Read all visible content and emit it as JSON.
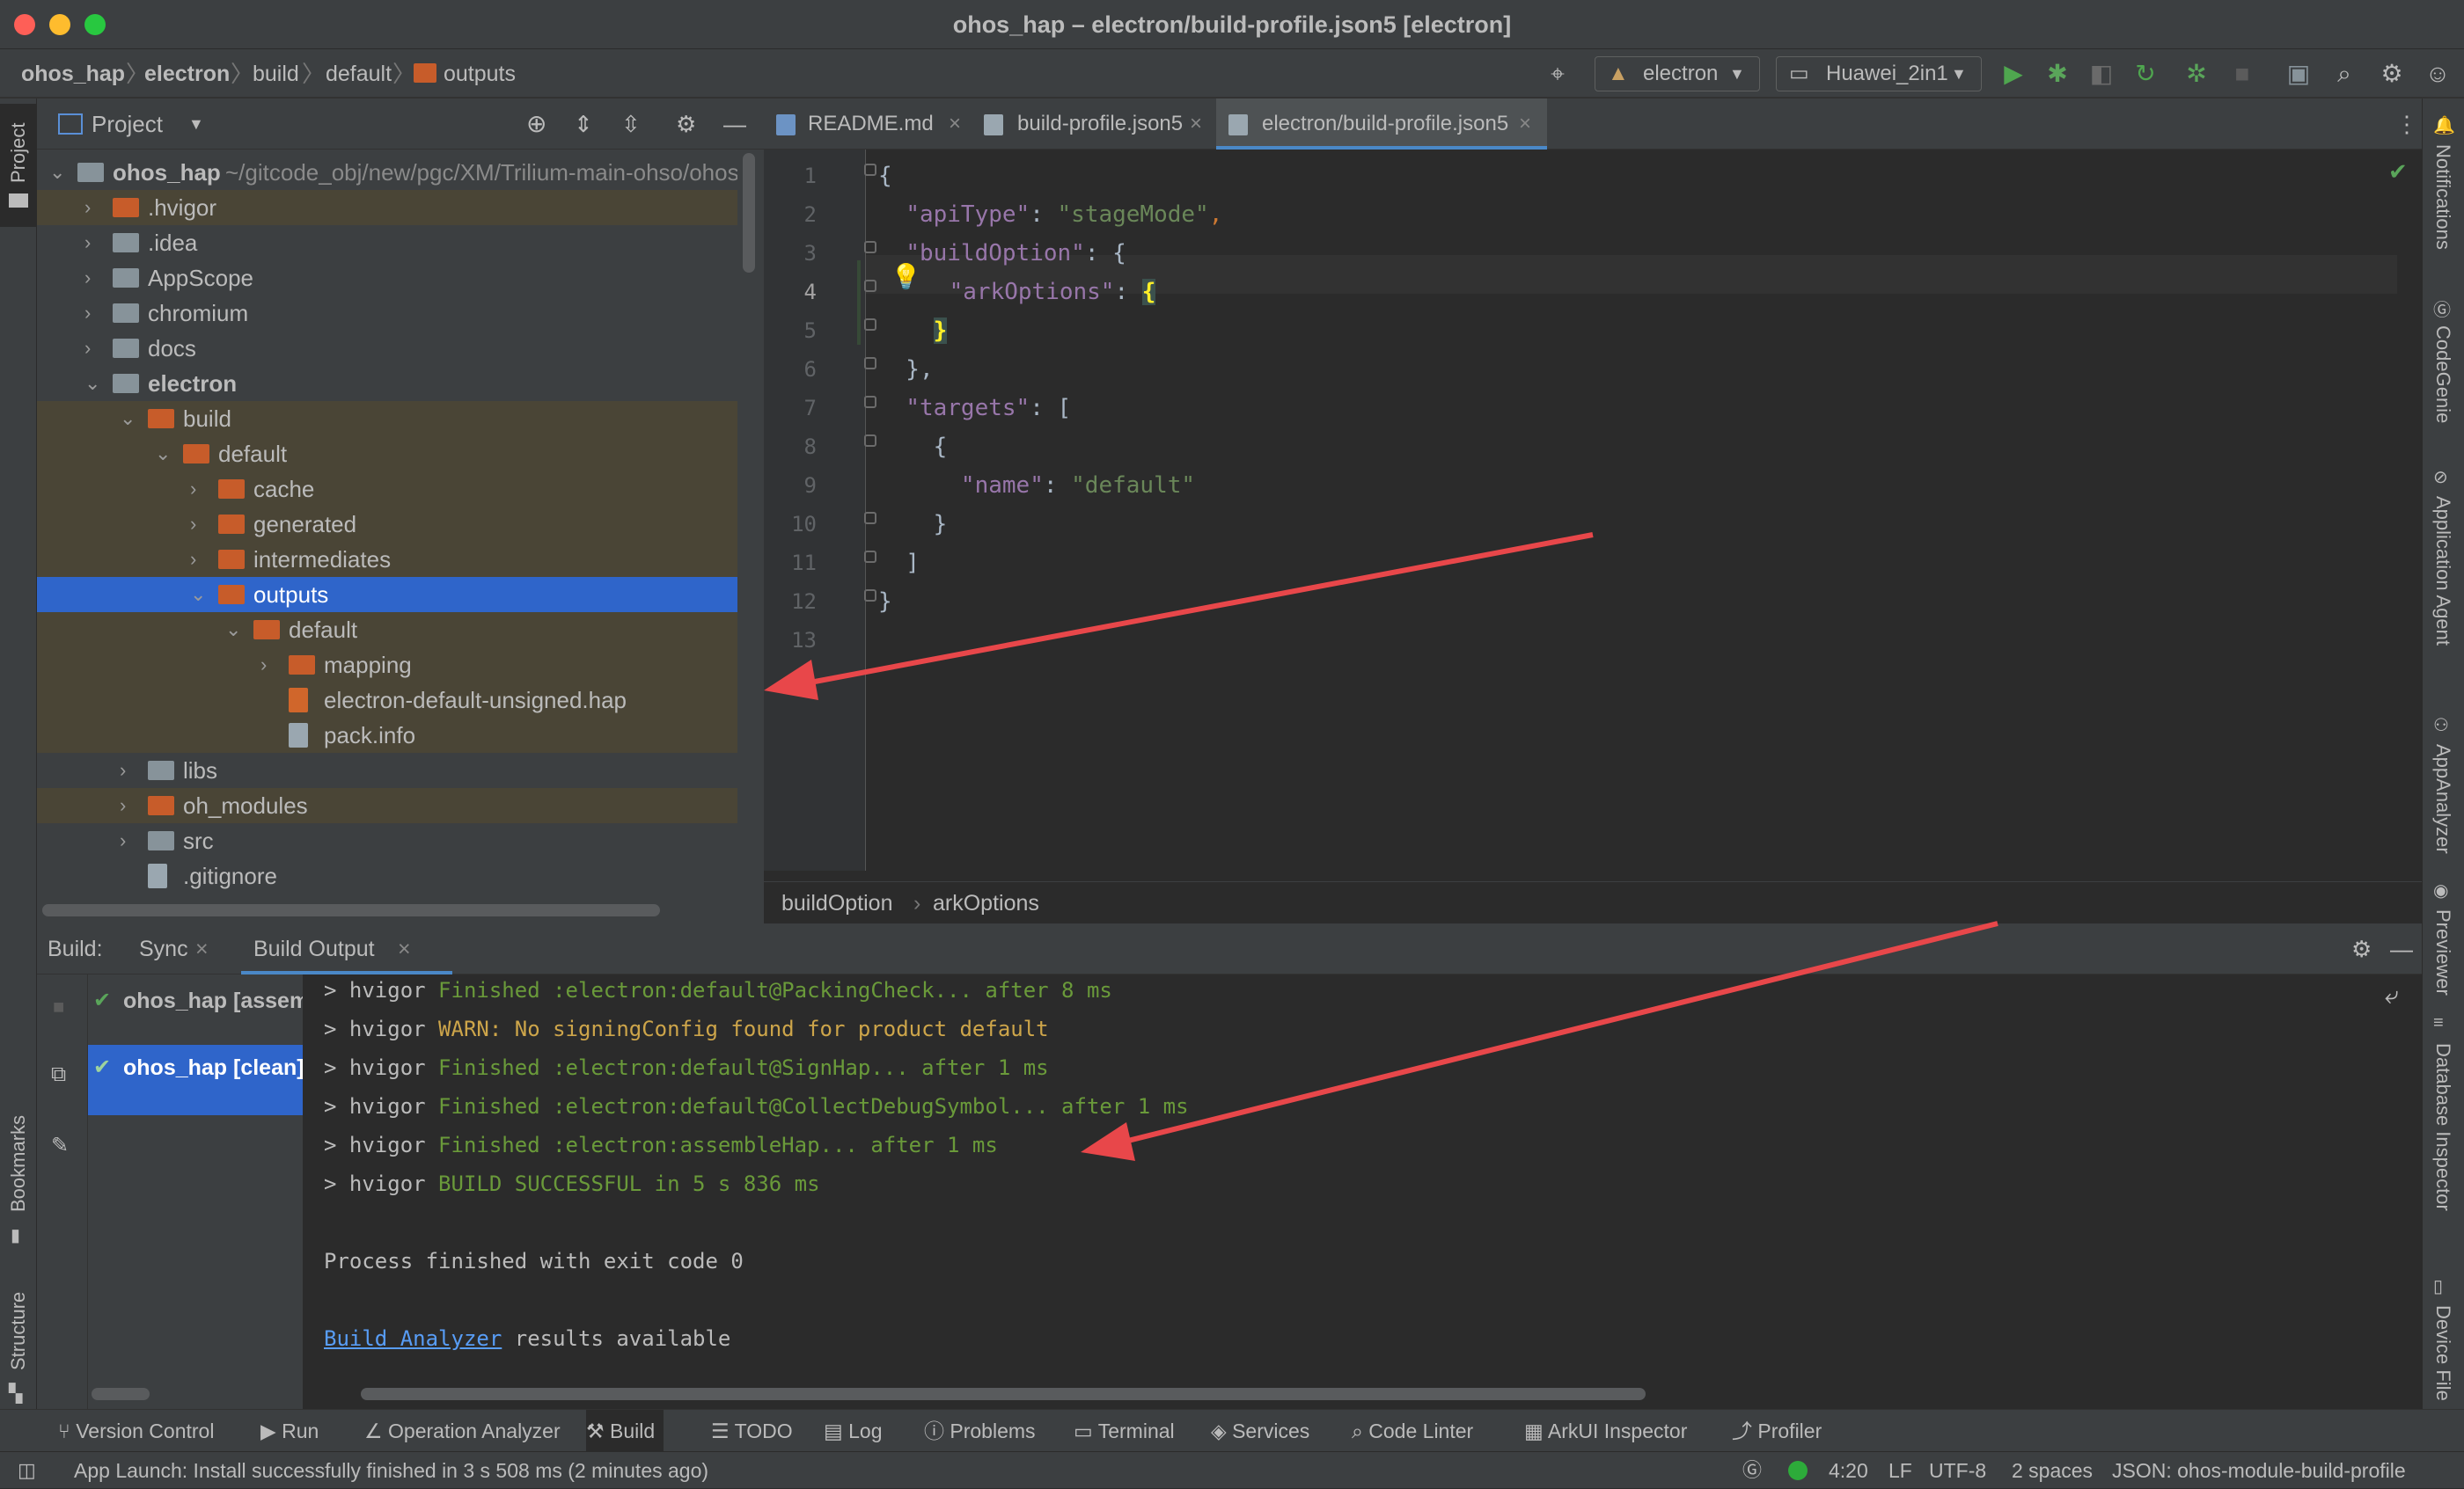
{
  "window": {
    "title": "ohos_hap – electron/build-profile.json5 [electron]"
  },
  "breadcrumb": [
    "ohos_hap",
    "electron",
    "build",
    "default",
    "outputs"
  ],
  "toolbar": {
    "module_select": "electron",
    "device_select": "Huawei_2in1"
  },
  "project_panel": {
    "title": "Project",
    "root_label": "ohos_hap",
    "root_path": "~/gitcode_obj/new/pgc/XM/Trilium-main-ohso/ohos_hap",
    "tree": [
      {
        "label": ".hvigor",
        "depth": 1,
        "kind": "folder-orange",
        "expanded": false,
        "excluded": true
      },
      {
        "label": ".idea",
        "depth": 1,
        "kind": "folder",
        "expanded": false
      },
      {
        "label": "AppScope",
        "depth": 1,
        "kind": "folder",
        "expanded": false
      },
      {
        "label": "chromium",
        "depth": 1,
        "kind": "folder",
        "expanded": false
      },
      {
        "label": "docs",
        "depth": 1,
        "kind": "folder",
        "expanded": false
      },
      {
        "label": "electron",
        "depth": 1,
        "kind": "module",
        "expanded": true,
        "bold": true
      },
      {
        "label": "build",
        "depth": 2,
        "kind": "folder-orange",
        "expanded": true,
        "excluded": true
      },
      {
        "label": "default",
        "depth": 3,
        "kind": "folder-orange",
        "expanded": true,
        "excluded": true
      },
      {
        "label": "cache",
        "depth": 4,
        "kind": "folder-orange",
        "expanded": false,
        "excluded": true
      },
      {
        "label": "generated",
        "depth": 4,
        "kind": "folder-orange",
        "expanded": false,
        "excluded": true
      },
      {
        "label": "intermediates",
        "depth": 4,
        "kind": "folder-orange",
        "expanded": false,
        "excluded": true
      },
      {
        "label": "outputs",
        "depth": 4,
        "kind": "folder-orange",
        "expanded": true,
        "selected": true
      },
      {
        "label": "default",
        "depth": 5,
        "kind": "folder-orange",
        "expanded": true,
        "excluded": true
      },
      {
        "label": "mapping",
        "depth": 6,
        "kind": "folder-orange",
        "expanded": false,
        "excluded": true
      },
      {
        "label": "electron-default-unsigned.hap",
        "depth": 6,
        "kind": "file-hap",
        "leaf": true,
        "excluded": true
      },
      {
        "label": "pack.info",
        "depth": 6,
        "kind": "file",
        "leaf": true,
        "excluded": true
      },
      {
        "label": "libs",
        "depth": 2,
        "kind": "folder",
        "expanded": false
      },
      {
        "label": "oh_modules",
        "depth": 2,
        "kind": "folder-orange",
        "expanded": false,
        "excluded": true
      },
      {
        "label": "src",
        "depth": 2,
        "kind": "folder",
        "expanded": false
      },
      {
        "label": ".gitignore",
        "depth": 2,
        "kind": "file",
        "leaf": true
      }
    ]
  },
  "editor": {
    "tabs": [
      {
        "label": "README.md",
        "active": false
      },
      {
        "label": "build-profile.json5",
        "active": false
      },
      {
        "label": "electron/build-profile.json5",
        "active": true
      }
    ],
    "lines": [
      [
        [
          "{",
          "plain"
        ]
      ],
      [
        [
          "  ",
          "plain"
        ],
        [
          "\"apiType\"",
          "key"
        ],
        [
          ": ",
          "plain"
        ],
        [
          "\"stageMode\"",
          "str"
        ],
        [
          ",",
          "punct"
        ]
      ],
      [
        [
          "  ",
          "plain"
        ],
        [
          "\"buildOption\"",
          "key"
        ],
        [
          ": {",
          "plain"
        ]
      ],
      [
        [
          "    ",
          "plain"
        ],
        [
          "\"arkOptions\"",
          "key"
        ],
        [
          ": ",
          "plain"
        ],
        [
          "{",
          "plain"
        ]
      ],
      [
        [
          "    ",
          "plain"
        ],
        [
          "}",
          "plain"
        ]
      ],
      [
        [
          "  },",
          "plain"
        ]
      ],
      [
        [
          "  ",
          "plain"
        ],
        [
          "\"targets\"",
          "key"
        ],
        [
          ": [",
          "plain"
        ]
      ],
      [
        [
          "    {",
          "plain"
        ]
      ],
      [
        [
          "      ",
          "plain"
        ],
        [
          "\"name\"",
          "key"
        ],
        [
          ": ",
          "plain"
        ],
        [
          "\"default\"",
          "str"
        ]
      ],
      [
        [
          "    }",
          "plain"
        ]
      ],
      [
        [
          "  ]",
          "plain"
        ]
      ],
      [
        [
          "}",
          "plain"
        ]
      ],
      [
        [
          "",
          "plain"
        ]
      ]
    ],
    "line_numbers": [
      "1",
      "2",
      "3",
      "4",
      "5",
      "6",
      "7",
      "8",
      "9",
      "10",
      "11",
      "12",
      "13"
    ],
    "breadcrumb": [
      "buildOption",
      "arkOptions"
    ]
  },
  "build_panel": {
    "label": "Build:",
    "tabs": [
      {
        "label": "Sync"
      },
      {
        "label": "Build Output"
      }
    ],
    "tasks": [
      {
        "label": "ohos_hap [assemble]",
        "selected": false
      },
      {
        "label": "ohos_hap [clean]",
        "selected": true
      }
    ],
    "console": [
      [
        [
          "> hvigor ",
          "plain"
        ],
        [
          "Finished :electron:default@PackingCheck... after 8 ms",
          "ok"
        ]
      ],
      [
        [
          "> hvigor ",
          "plain"
        ],
        [
          "WARN: No signingConfig found for product default",
          "warn"
        ]
      ],
      [
        [
          "> hvigor ",
          "plain"
        ],
        [
          "Finished :electron:default@SignHap... after 1 ms",
          "ok"
        ]
      ],
      [
        [
          "> hvigor ",
          "plain"
        ],
        [
          "Finished :electron:default@CollectDebugSymbol... after 1 ms",
          "ok"
        ]
      ],
      [
        [
          "> hvigor ",
          "plain"
        ],
        [
          "Finished :electron:assembleHap... after 1 ms",
          "ok"
        ]
      ],
      [
        [
          "> hvigor ",
          "plain"
        ],
        [
          "BUILD SUCCESSFUL in 5 s 836 ms",
          "ok"
        ]
      ],
      [
        [
          "",
          "plain"
        ]
      ],
      [
        [
          "Process finished with exit code 0",
          "plain"
        ]
      ],
      [
        [
          "",
          "plain"
        ]
      ],
      [
        [
          "Build Analyzer",
          "link"
        ],
        [
          " results available",
          "plain"
        ]
      ]
    ]
  },
  "tool_windows": [
    "Version Control",
    "Run",
    "Operation Analyzer",
    "Build",
    "TODO",
    "Log",
    "Problems",
    "Terminal",
    "Services",
    "Code Linter",
    "ArkUI Inspector",
    "Profiler"
  ],
  "left_strip": {
    "top": "Project",
    "bottom": [
      "Bookmarks",
      "Structure"
    ]
  },
  "right_strip": [
    "Notifications",
    "CodeGenie",
    "Application Agent",
    "AppAnalyzer",
    "Previewer",
    "Database Inspector",
    "Device File"
  ],
  "status_bar": {
    "message": "App Launch: Install successfully finished in 3 s 508 ms (2 minutes ago)",
    "position": "4:20",
    "line_sep": "LF",
    "encoding": "UTF-8",
    "indent": "2 spaces",
    "schema": "JSON: ohos-module-build-profile"
  },
  "colors": {
    "selection": "#2f65ca",
    "excluded_bg": "#4a4536",
    "arrow": "#e8474a",
    "keyword": "#9876aa",
    "string": "#6a8759",
    "success": "#6a9a3a",
    "warn": "#cda54a"
  }
}
